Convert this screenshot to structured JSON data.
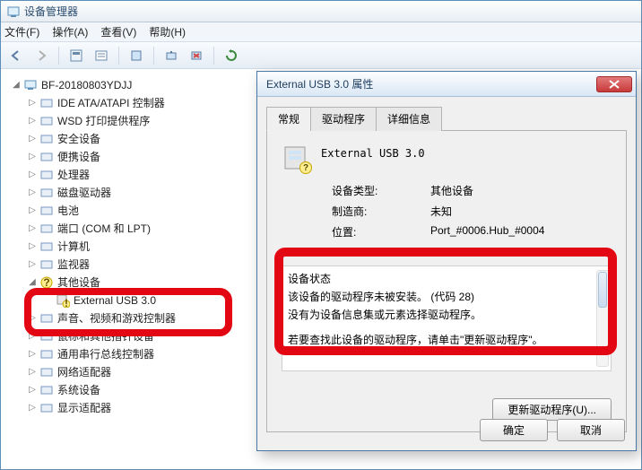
{
  "window": {
    "title": "设备管理器"
  },
  "menu": {
    "file": "文件(F)",
    "action": "操作(A)",
    "view": "查看(V)",
    "help": "帮助(H)"
  },
  "tree": {
    "root": "BF-20180803YDJJ",
    "items": [
      "IDE ATA/ATAPI 控制器",
      "WSD 打印提供程序",
      "安全设备",
      "便携设备",
      "处理器",
      "磁盘驱动器",
      "电池",
      "端口 (COM 和 LPT)",
      "计算机",
      "监视器"
    ],
    "other_devices": "其他设备",
    "ext_usb": "External USB 3.0",
    "items2": [
      "声音、视频和游戏控制器",
      "鼠标和其他指针设备",
      "通用串行总线控制器",
      "网络适配器",
      "系统设备",
      "显示适配器"
    ]
  },
  "dialog": {
    "title": "External USB 3.0 属性",
    "tabs": {
      "general": "常规",
      "driver": "驱动程序",
      "details": "详细信息"
    },
    "device_name": "External USB 3.0",
    "type_label": "设备类型:",
    "type_value": "其他设备",
    "mfr_label": "制造商:",
    "mfr_value": "未知",
    "loc_label": "位置:",
    "loc_value": "Port_#0006.Hub_#0004",
    "status_title": "设备状态",
    "status1": "该设备的驱动程序未被安装。 (代码 28)",
    "status2": "没有为设备信息集或元素选择驱动程序。",
    "status3": "若要查找此设备的驱动程序，请单击\"更新驱动程序\"。",
    "update_btn": "更新驱动程序(U)...",
    "ok": "确定",
    "cancel": "取消"
  }
}
